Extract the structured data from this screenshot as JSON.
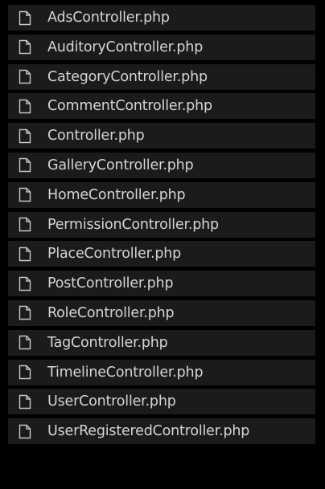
{
  "explorer": {
    "files": [
      {
        "name": "AdsController.php",
        "icon": "file-icon"
      },
      {
        "name": "AuditoryController.php",
        "icon": "file-icon"
      },
      {
        "name": "CategoryController.php",
        "icon": "file-icon"
      },
      {
        "name": "CommentController.php",
        "icon": "file-icon"
      },
      {
        "name": "Controller.php",
        "icon": "file-icon"
      },
      {
        "name": "GalleryController.php",
        "icon": "file-icon"
      },
      {
        "name": "HomeController.php",
        "icon": "file-icon"
      },
      {
        "name": "PermissionController.php",
        "icon": "file-icon"
      },
      {
        "name": "PlaceController.php",
        "icon": "file-icon"
      },
      {
        "name": "PostController.php",
        "icon": "file-icon"
      },
      {
        "name": "RoleController.php",
        "icon": "file-icon"
      },
      {
        "name": "TagController.php",
        "icon": "file-icon"
      },
      {
        "name": "TimelineController.php",
        "icon": "file-icon"
      },
      {
        "name": "UserController.php",
        "icon": "file-icon"
      },
      {
        "name": "UserRegisteredController.php",
        "icon": "file-icon"
      }
    ]
  },
  "colors": {
    "background": "#000000",
    "row_background": "#1b1b1b",
    "text": "#d4d4d4",
    "icon_stroke": "#c8c8c8"
  }
}
